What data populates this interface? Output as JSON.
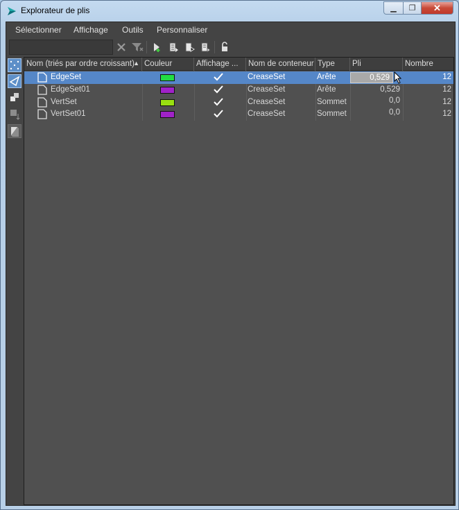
{
  "window": {
    "title": "Explorateur de plis"
  },
  "menu": {
    "items": [
      "Sélectionner",
      "Affichage",
      "Outils",
      "Personnaliser"
    ]
  },
  "search": {
    "value": "",
    "placeholder": ""
  },
  "columns": {
    "name": "Nom (triés par ordre croissant)",
    "color": "Couleur",
    "display": "Affichage ...",
    "container": "Nom de conteneur",
    "type": "Type",
    "crease": "Pli",
    "count": "Nombre"
  },
  "rows": [
    {
      "name": "EdgeSet",
      "color": "#22dd44",
      "display": true,
      "container": "CreaseSet",
      "type": "Arête",
      "crease": "0,529",
      "count": "12",
      "selected": true
    },
    {
      "name": "EdgeSet01",
      "color": "#a022c8",
      "display": true,
      "container": "CreaseSet",
      "type": "Arête",
      "crease": "0,529",
      "count": "12",
      "selected": false
    },
    {
      "name": "VertSet",
      "color": "#99e011",
      "display": true,
      "container": "CreaseSet",
      "type": "Sommet",
      "crease": "0,0",
      "count": "12",
      "selected": false
    },
    {
      "name": "VertSet01",
      "color": "#a022c8",
      "display": true,
      "container": "CreaseSet",
      "type": "Sommet",
      "crease": "0,0",
      "count": "12",
      "selected": false
    }
  ]
}
